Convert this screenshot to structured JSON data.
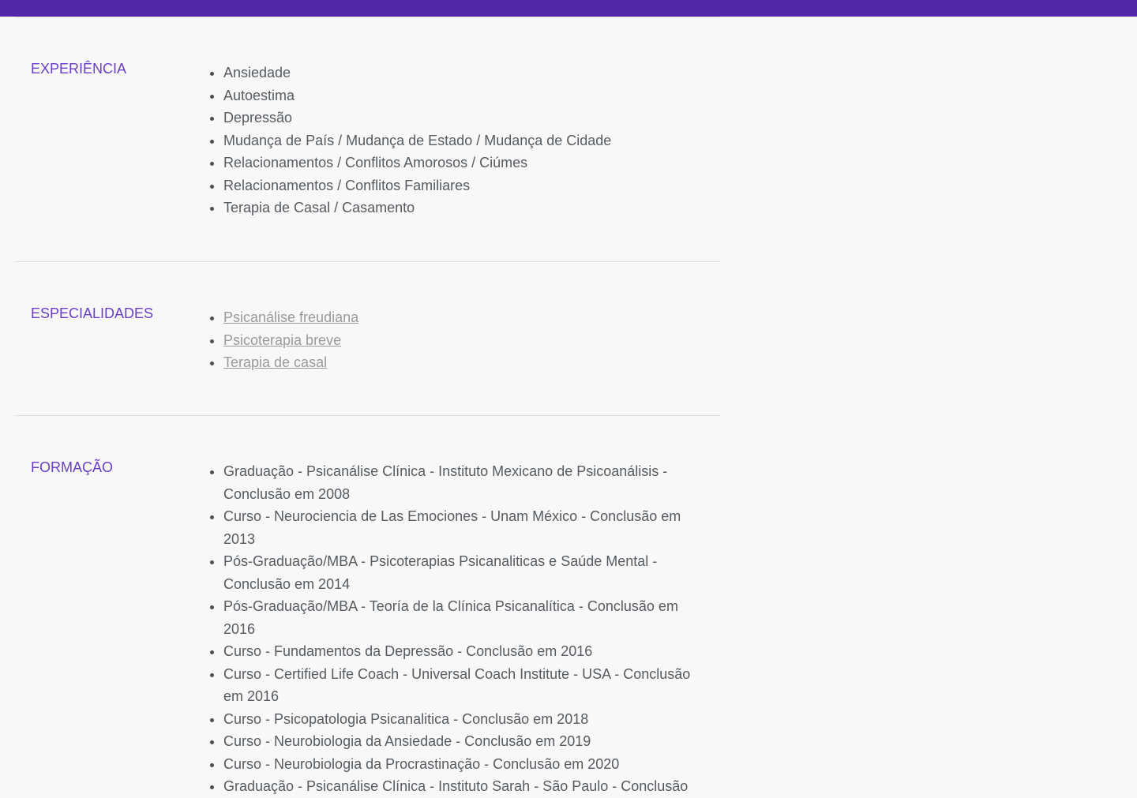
{
  "colors": {
    "topbar": "#5128a8",
    "label": "#6a3fc7",
    "text": "#555b60",
    "link": "#9a9a9a",
    "divider": "#dedede",
    "background": "#f8f8f8"
  },
  "experience": {
    "label": "EXPERIÊNCIA",
    "items": [
      "Ansiedade",
      "Autoestima",
      "Depressão",
      "Mudança de País / Mudança de Estado / Mudança de Cidade",
      "Relacionamentos / Conflitos Amorosos / Ciúmes",
      "Relacionamentos / Conflitos Familiares",
      "Terapia de Casal / Casamento"
    ]
  },
  "specialties": {
    "label": "ESPECIALIDADES",
    "items": [
      "Psicanálise freudiana",
      "Psicoterapia breve",
      "Terapia de casal"
    ]
  },
  "education": {
    "label": "FORMAÇÃO",
    "items": [
      "Graduação - Psicanálise Clínica - Instituto Mexicano de Psicoanálisis - Conclusão em 2008",
      "Curso - Neurociencia de Las Emociones - Unam México - Conclusão em 2013",
      "Pós-Graduação/MBA - Psicoterapias Psicanaliticas e Saúde Mental - Conclusão em 2014",
      "Pós-Graduação/MBA - Teoría de la Clínica Psicanalítica - Conclusão em 2016",
      "Curso - Fundamentos da Depressão - Conclusão em 2016",
      "Curso - Certified Life Coach - Universal Coach Institute - USA - Conclusão em 2016",
      "Curso - Psicopatologia Psicanalitica - Conclusão em 2018",
      "Curso - Neurobiologia da Ansiedade - Conclusão em 2019",
      "Curso - Neurobiologia da Procrastinação - Conclusão em 2020",
      "Graduação - Psicanálise Clínica - Instituto Sarah - São Paulo - Conclusão"
    ]
  }
}
